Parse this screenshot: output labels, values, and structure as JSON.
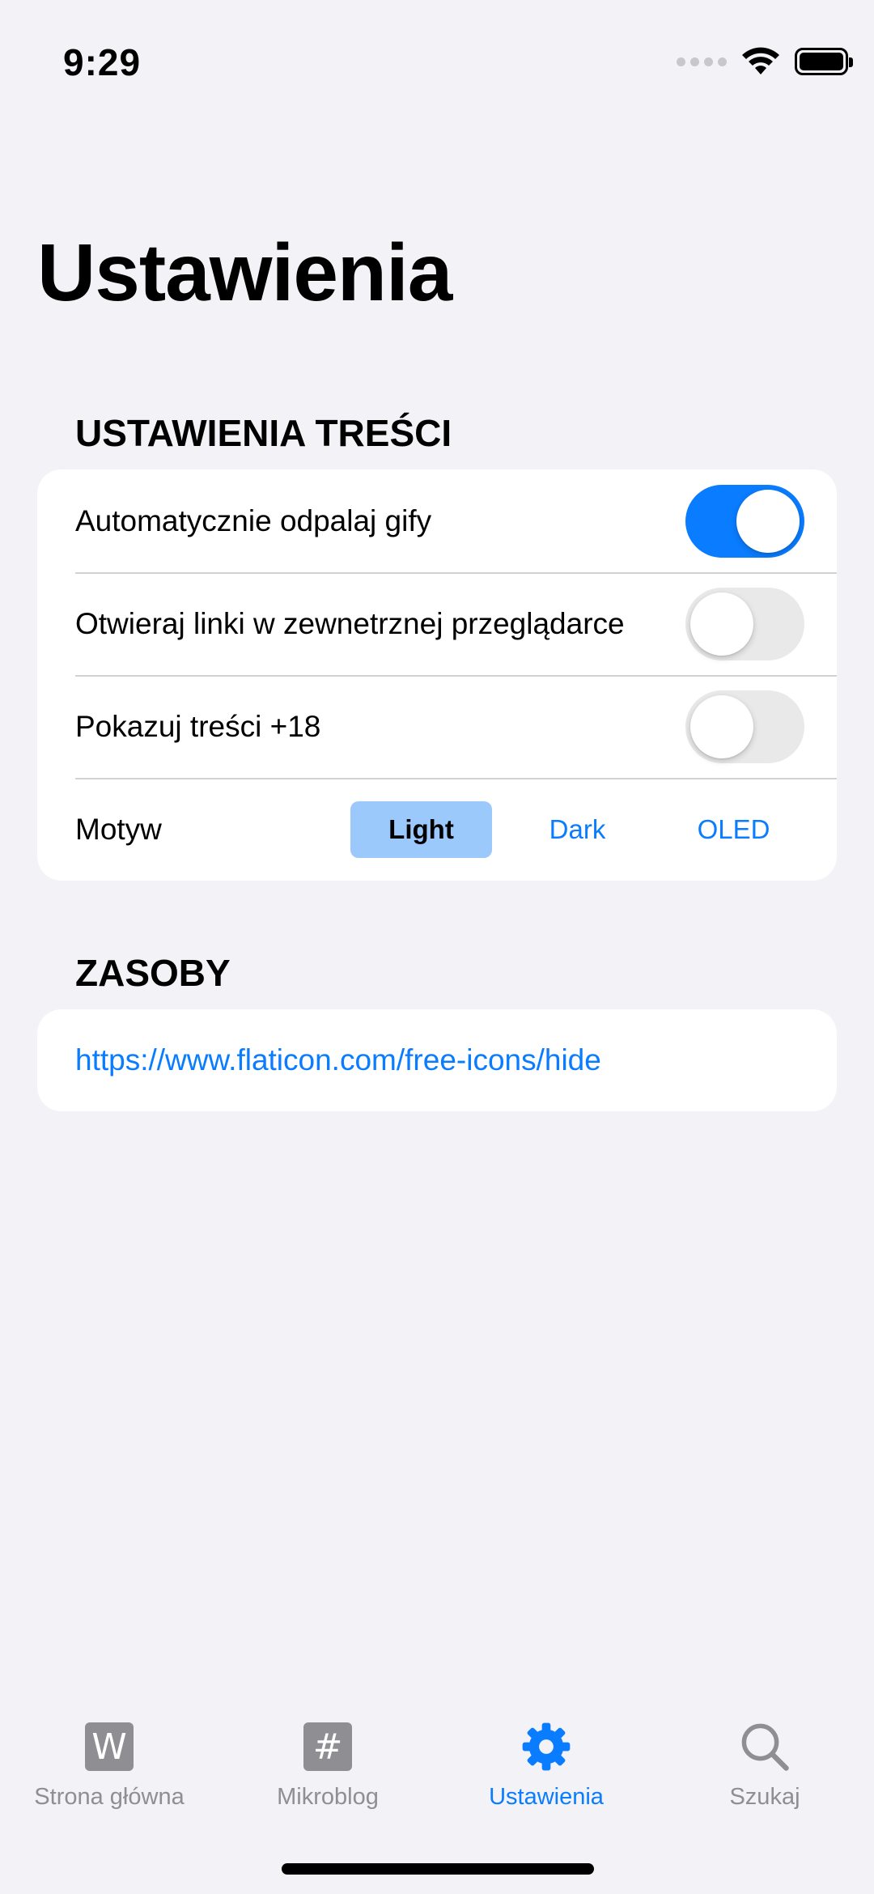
{
  "status_bar": {
    "time": "9:29"
  },
  "page_title": "Ustawienia",
  "content_section": {
    "header": "USTAWIENIA TREŚCI",
    "toggles": [
      {
        "label": "Automatycznie odpalaj gify",
        "on": true
      },
      {
        "label": "Otwieraj linki w zewnetrznej przeglądarce",
        "on": false
      },
      {
        "label": "Pokazuj treści +18",
        "on": false
      }
    ],
    "theme": {
      "label": "Motyw",
      "options": [
        "Light",
        "Dark",
        "OLED"
      ],
      "selected": "Light"
    }
  },
  "resources_section": {
    "header": "ZASOBY",
    "link": "https://www.flaticon.com/free-icons/hide"
  },
  "tab_bar": {
    "items": [
      {
        "label": "Strona główna",
        "glyph": "W",
        "icon": "wykop-w-icon"
      },
      {
        "label": "Mikroblog",
        "glyph": "#",
        "icon": "hashtag-icon"
      },
      {
        "label": "Ustawienia",
        "icon": "gear-icon"
      },
      {
        "label": "Szukaj",
        "icon": "search-icon"
      }
    ],
    "active": "Ustawienia"
  },
  "colors": {
    "accent": "#0a7cff",
    "background": "#f2f2f7",
    "inactive": "#8e8e93",
    "selected_segment": "#9bc9fb"
  }
}
